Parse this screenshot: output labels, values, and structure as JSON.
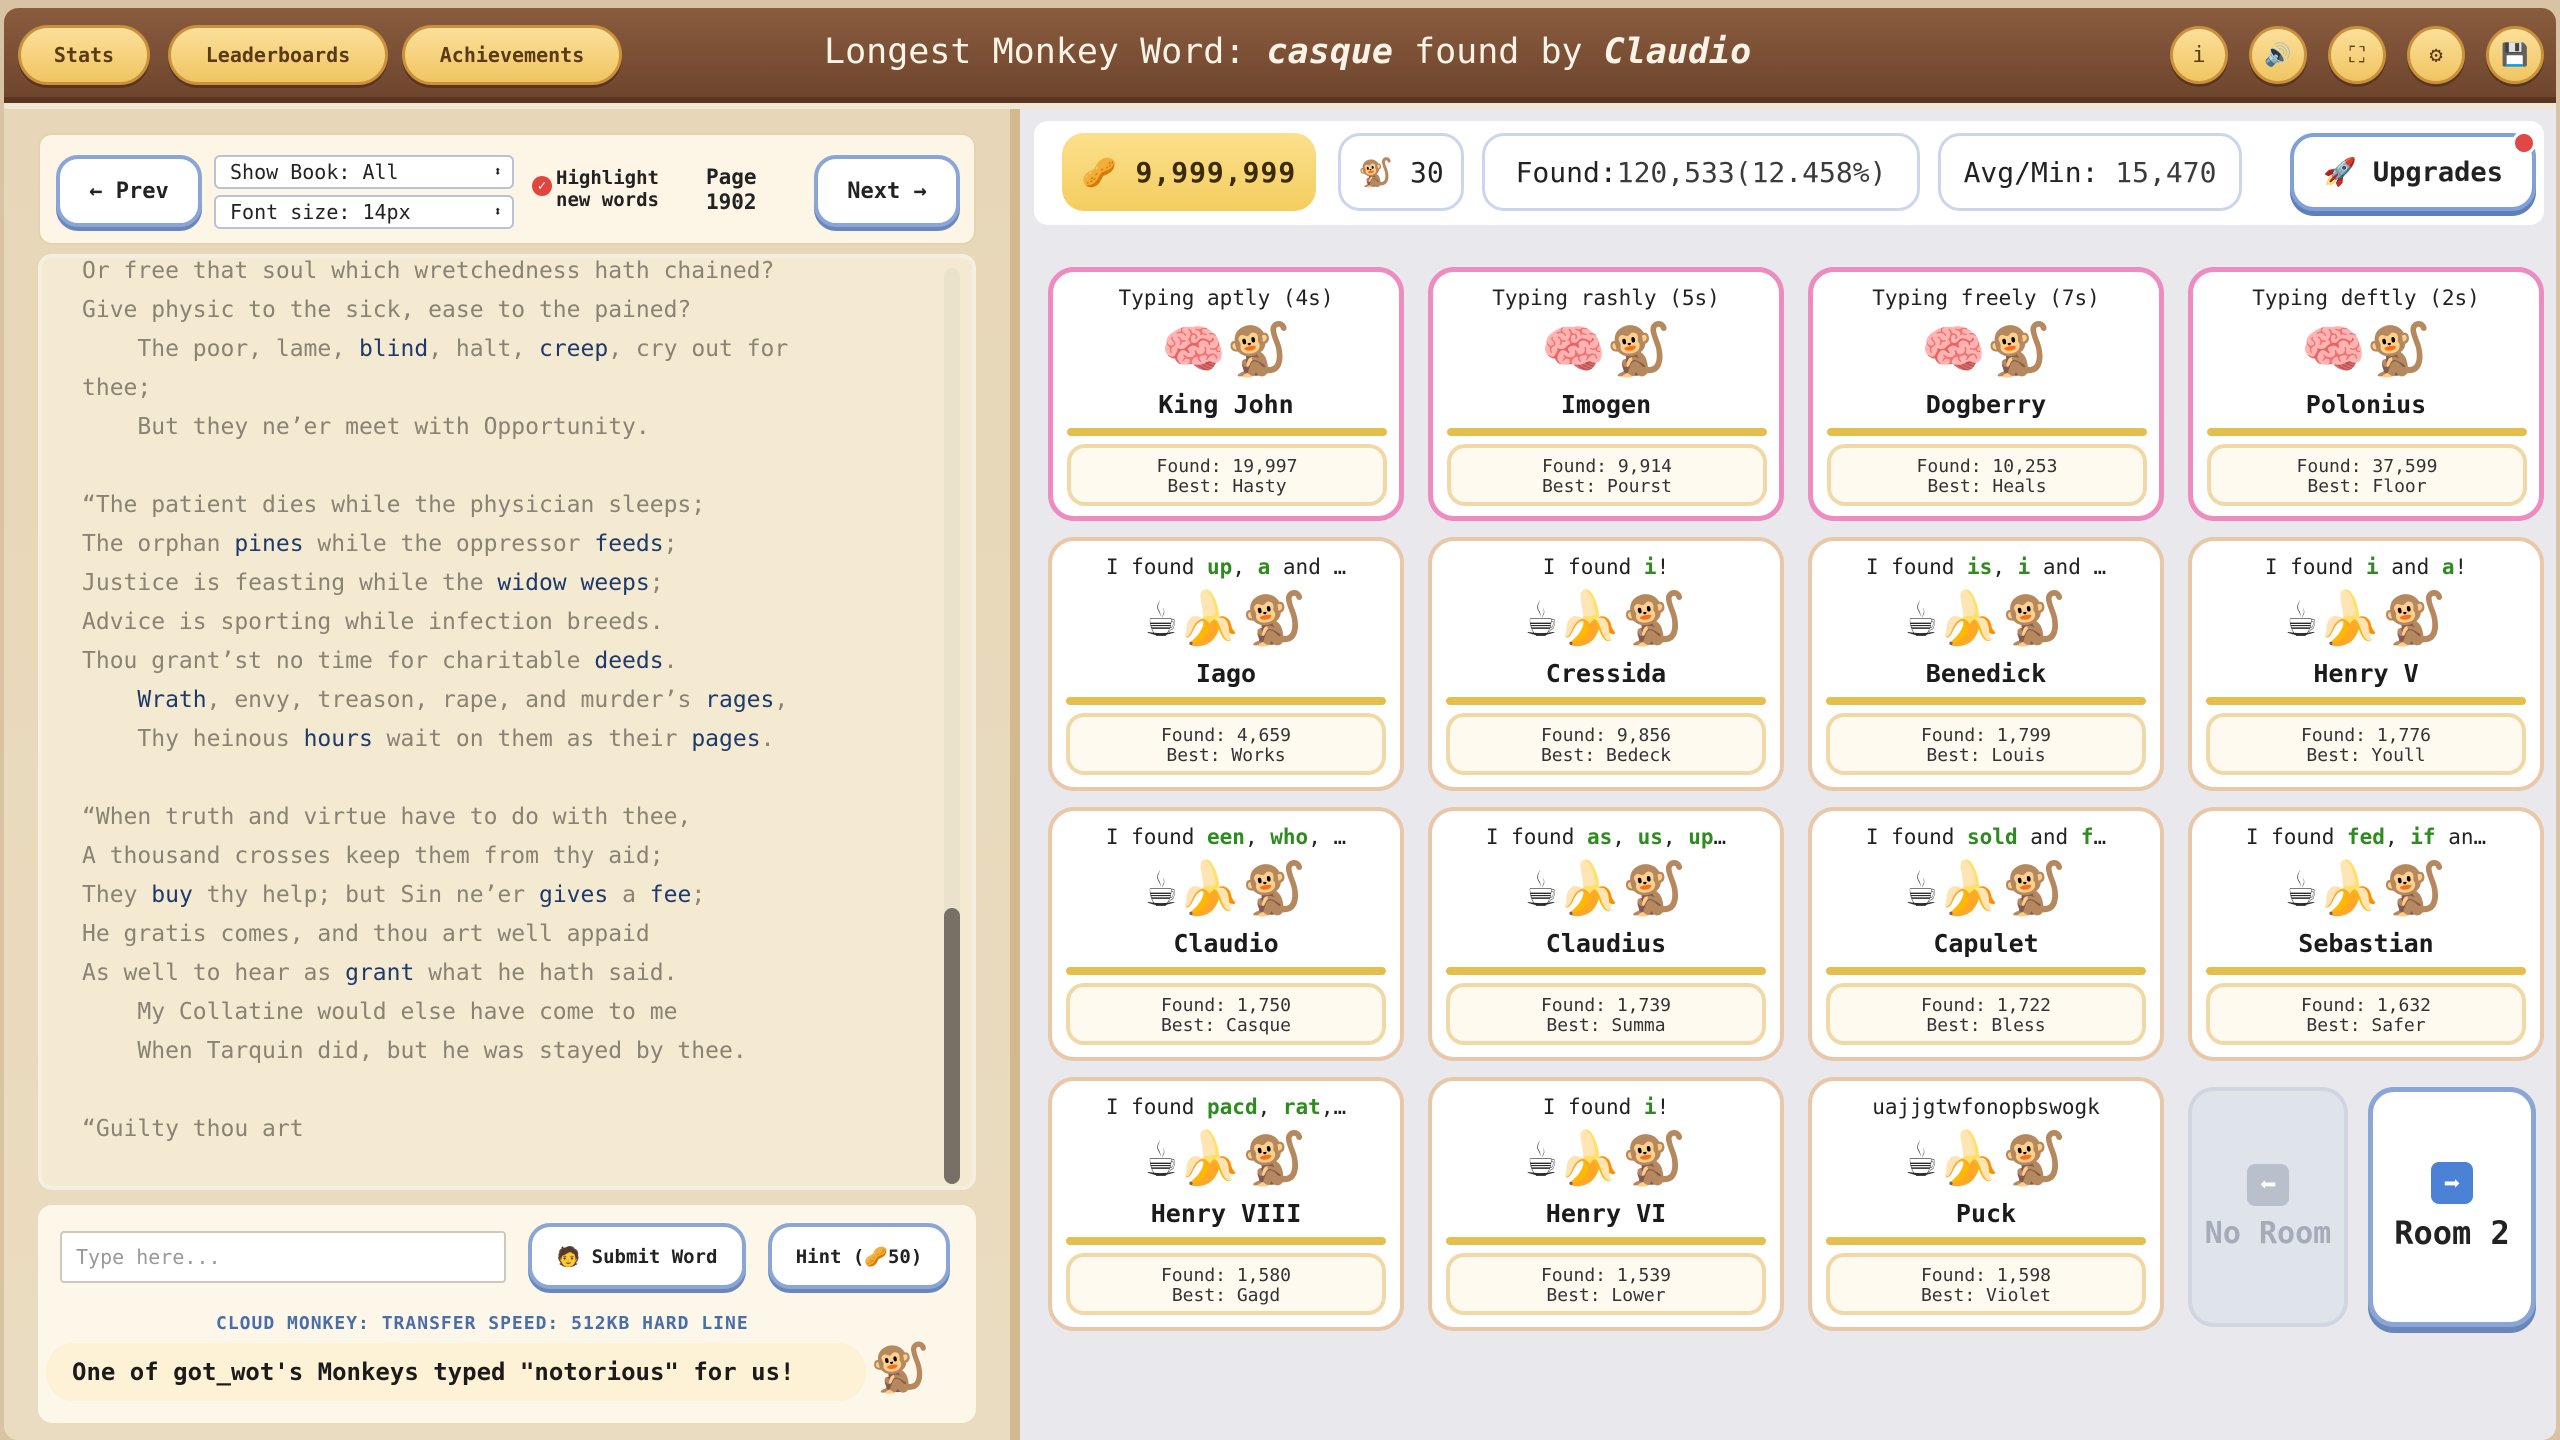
{
  "header": {
    "buttons": [
      "Stats",
      "Leaderboards",
      "Achievements"
    ],
    "title_prefix": "Longest Monkey Word: ",
    "title_word": "casque",
    "title_mid": " found by ",
    "title_user": "Claudio",
    "icons": [
      "info-icon",
      "sound-icon",
      "fullscreen-icon",
      "settings-icon",
      "save-icon"
    ],
    "icon_glyphs": [
      "i",
      "🔊",
      "⛶",
      "⚙",
      "💾"
    ]
  },
  "toolbar": {
    "prev_label": "← Prev",
    "next_label": "Next →",
    "show_book": "Show Book: All",
    "font_size": "Font size: 14px",
    "highlight_label_1": "Highlight",
    "highlight_label_2": "new words",
    "highlight_checked": true,
    "page_label": "Page",
    "page_number": "1902"
  },
  "book": {
    "lines": [
      [
        {
          "t": "Or free that soul which wretchedness hath chained?"
        }
      ],
      [
        {
          "t": "Give physic to the sick, ease to the pained?"
        }
      ],
      [
        {
          "t": "    The poor, lame, "
        },
        {
          "t": "blind",
          "h": 1
        },
        {
          "t": ", halt, "
        },
        {
          "t": "creep",
          "h": 1
        },
        {
          "t": ", cry out for"
        }
      ],
      [
        {
          "t": "thee;"
        }
      ],
      [
        {
          "t": "    But they ne’er meet with Opportunity."
        }
      ],
      [
        {
          "t": ""
        }
      ],
      [
        {
          "t": "“The patient dies while the physician sleeps;"
        }
      ],
      [
        {
          "t": "The orphan "
        },
        {
          "t": "pines",
          "h": 1
        },
        {
          "t": " while the oppressor "
        },
        {
          "t": "feeds",
          "h": 1
        },
        {
          "t": ";"
        }
      ],
      [
        {
          "t": "Justice is feasting while the "
        },
        {
          "t": "widow weeps",
          "h": 1
        },
        {
          "t": ";"
        }
      ],
      [
        {
          "t": "Advice is sporting while infection breeds."
        }
      ],
      [
        {
          "t": "Thou grant’st no time for charitable "
        },
        {
          "t": "deeds",
          "h": 1
        },
        {
          "t": "."
        }
      ],
      [
        {
          "t": "    "
        },
        {
          "t": "Wrath",
          "h": 1
        },
        {
          "t": ", envy, treason, rape, and murder’s "
        },
        {
          "t": "rages",
          "h": 1
        },
        {
          "t": ","
        }
      ],
      [
        {
          "t": "    Thy heinous "
        },
        {
          "t": "hours",
          "h": 1
        },
        {
          "t": " wait on them as their "
        },
        {
          "t": "pages",
          "h": 1
        },
        {
          "t": "."
        }
      ],
      [
        {
          "t": ""
        }
      ],
      [
        {
          "t": "“When truth and virtue have to do with thee,"
        }
      ],
      [
        {
          "t": "A thousand crosses keep them from thy aid;"
        }
      ],
      [
        {
          "t": "They "
        },
        {
          "t": "buy",
          "h": 1
        },
        {
          "t": " thy help; but Sin ne’er "
        },
        {
          "t": "gives",
          "h": 1
        },
        {
          "t": " a "
        },
        {
          "t": "fee",
          "h": 1
        },
        {
          "t": ";"
        }
      ],
      [
        {
          "t": "He gratis comes, and thou art well appaid"
        }
      ],
      [
        {
          "t": "As well to hear as "
        },
        {
          "t": "grant",
          "h": 1
        },
        {
          "t": " what he hath said."
        }
      ],
      [
        {
          "t": "    My Collatine would else have come to me"
        }
      ],
      [
        {
          "t": "    When Tarquin did, but he was stayed by thee."
        }
      ],
      [
        {
          "t": ""
        }
      ],
      [
        {
          "t": "“Guilty thou art"
        }
      ]
    ],
    "scroll_position": 0.7
  },
  "input": {
    "placeholder": "Type here...",
    "submit_label": "🧑 Submit Word",
    "hint_label": "Hint (🥜50)",
    "cloud_text": "CLOUD MONKEY: TRANSFER SPEED: 512KB HARD LINE",
    "message": "One of got_wot's Monkeys typed \"notorious\" for us!"
  },
  "stats": {
    "peanuts": "🥜 9,999,999",
    "monkeys": "🐒 30",
    "found_label": "Found:",
    "found_value": "120,533(12.458%)",
    "avg_label": "Avg/Min:",
    "avg_value": "15,470",
    "upgrades_label": "🚀 Upgrades"
  },
  "cards": [
    {
      "title": [
        {
          "t": "Typing aptly (4s)"
        }
      ],
      "emoji": "🧠🐒",
      "name": "King John",
      "found": "Found: 19,997",
      "best": "Best: Hasty",
      "pink": true
    },
    {
      "title": [
        {
          "t": "Typing rashly (5s)"
        }
      ],
      "emoji": "🧠🐒",
      "name": "Imogen",
      "found": "Found: 9,914",
      "best": "Best: Pourst",
      "pink": true
    },
    {
      "title": [
        {
          "t": "Typing freely (7s)"
        }
      ],
      "emoji": "🧠🐒",
      "name": "Dogberry",
      "found": "Found: 10,253",
      "best": "Best: Heals",
      "pink": true
    },
    {
      "title": [
        {
          "t": "Typing deftly (2s)"
        }
      ],
      "emoji": "🧠🐒",
      "name": "Polonius",
      "found": "Found: 37,599",
      "best": "Best: Floor",
      "pink": true
    },
    {
      "title": [
        {
          "t": "I found "
        },
        {
          "t": "up",
          "g": 1
        },
        {
          "t": ", "
        },
        {
          "t": "a",
          "g": 1
        },
        {
          "t": " and …"
        }
      ],
      "emoji": "☕🍌🐒",
      "name": "Iago",
      "found": "Found: 4,659",
      "best": "Best: Works"
    },
    {
      "title": [
        {
          "t": "I found "
        },
        {
          "t": "i",
          "g": 1
        },
        {
          "t": "!"
        }
      ],
      "emoji": "☕🍌🐒",
      "name": "Cressida",
      "found": "Found: 9,856",
      "best": "Best: Bedeck"
    },
    {
      "title": [
        {
          "t": "I found "
        },
        {
          "t": "is",
          "g": 1
        },
        {
          "t": ", "
        },
        {
          "t": "i",
          "g": 1
        },
        {
          "t": " and …"
        }
      ],
      "emoji": "☕🍌🐒",
      "name": "Benedick",
      "found": "Found: 1,799",
      "best": "Best: Louis"
    },
    {
      "title": [
        {
          "t": "I found "
        },
        {
          "t": "i",
          "g": 1
        },
        {
          "t": " and "
        },
        {
          "t": "a",
          "g": 1
        },
        {
          "t": "!"
        }
      ],
      "emoji": "☕🍌🐒",
      "name": "Henry V",
      "found": "Found: 1,776",
      "best": "Best: Youll"
    },
    {
      "title": [
        {
          "t": "I found "
        },
        {
          "t": "een",
          "g": 1
        },
        {
          "t": ", "
        },
        {
          "t": "who",
          "g": 1
        },
        {
          "t": ", …"
        }
      ],
      "emoji": "☕🍌🐒",
      "name": "Claudio",
      "found": "Found: 1,750",
      "best": "Best: Casque"
    },
    {
      "title": [
        {
          "t": "I found "
        },
        {
          "t": "as",
          "g": 1
        },
        {
          "t": ", "
        },
        {
          "t": "us",
          "g": 1
        },
        {
          "t": ", "
        },
        {
          "t": "up",
          "g": 1
        },
        {
          "t": "…"
        }
      ],
      "emoji": "☕🍌🐒",
      "name": "Claudius",
      "found": "Found: 1,739",
      "best": "Best: Summa"
    },
    {
      "title": [
        {
          "t": "I found "
        },
        {
          "t": "sold",
          "g": 1
        },
        {
          "t": " and "
        },
        {
          "t": "f",
          "g": 1
        },
        {
          "t": "…"
        }
      ],
      "emoji": "☕🍌🐒",
      "name": "Capulet",
      "found": "Found: 1,722",
      "best": "Best: Bless"
    },
    {
      "title": [
        {
          "t": "I found "
        },
        {
          "t": "fed",
          "g": 1
        },
        {
          "t": ", "
        },
        {
          "t": "if",
          "g": 1
        },
        {
          "t": " an…"
        }
      ],
      "emoji": "☕🍌🐒",
      "name": "Sebastian",
      "found": "Found: 1,632",
      "best": "Best: Safer"
    },
    {
      "title": [
        {
          "t": "I found "
        },
        {
          "t": "pacd",
          "g": 1
        },
        {
          "t": ", "
        },
        {
          "t": "rat",
          "g": 1
        },
        {
          "t": ",…"
        }
      ],
      "emoji": "☕🍌🐒",
      "name": "Henry VIII",
      "found": "Found: 1,580",
      "best": "Best: Gagd"
    },
    {
      "title": [
        {
          "t": "I found "
        },
        {
          "t": "i",
          "g": 1
        },
        {
          "t": "!"
        }
      ],
      "emoji": "☕🍌🐒",
      "name": "Henry VI",
      "found": "Found: 1,539",
      "best": "Best: Lower"
    },
    {
      "title": [
        {
          "t": "uajjgtwfonopbswogk"
        }
      ],
      "emoji": "☕🍌🐒",
      "name": "Puck",
      "found": "Found: 1,598",
      "best": "Best: Violet"
    }
  ],
  "rooms": {
    "prev_label": "No Room",
    "next_label": "Room 2",
    "prev_arrow": "⬅",
    "next_arrow": "➡"
  }
}
